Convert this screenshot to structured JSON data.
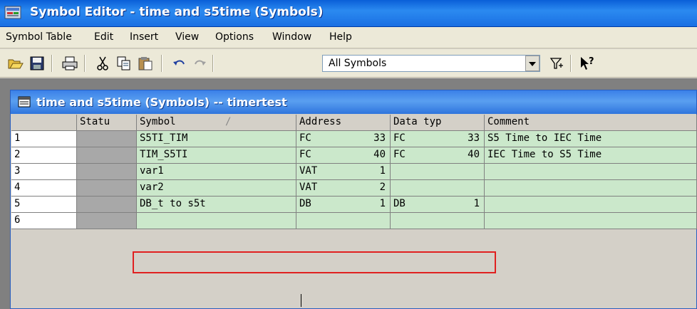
{
  "window": {
    "title": "Symbol Editor - time and s5time (Symbols)",
    "icon": "symbol-editor-icon"
  },
  "menu": {
    "items": [
      "Symbol Table",
      "Edit",
      "Insert",
      "View",
      "Options",
      "Window",
      "Help"
    ]
  },
  "toolbar": {
    "icons": [
      "open-folder-icon",
      "save-icon",
      "print-icon",
      "cut-icon",
      "copy-icon",
      "paste-icon",
      "undo-icon",
      "redo-icon",
      "filter-icon",
      "help-pointer-icon"
    ],
    "filter_value": "All Symbols"
  },
  "child_window": {
    "title": "time and s5time (Symbols) -- timertest"
  },
  "table": {
    "headers": {
      "rownum": "",
      "status": "Statu",
      "symbol": "Symbol",
      "sort_indicator": "/",
      "address": "Address",
      "datatype": "Data typ",
      "comment": "Comment"
    },
    "rows": [
      {
        "num": "1",
        "symbol": "S5TI_TIM",
        "addr_type": "FC",
        "addr_num": "33",
        "dt_type": "FC",
        "dt_num": "33",
        "comment": "S5 Time to IEC Time"
      },
      {
        "num": "2",
        "symbol": "TIM_S5TI",
        "addr_type": "FC",
        "addr_num": "40",
        "dt_type": "FC",
        "dt_num": "40",
        "comment": "IEC Time to S5 Time"
      },
      {
        "num": "3",
        "symbol": "var1",
        "addr_type": "VAT",
        "addr_num": "1",
        "dt_type": "",
        "dt_num": "",
        "comment": ""
      },
      {
        "num": "4",
        "symbol": "var2",
        "addr_type": "VAT",
        "addr_num": "2",
        "dt_type": "",
        "dt_num": "",
        "comment": ""
      },
      {
        "num": "5",
        "symbol": "DB_t to s5t",
        "addr_type": "DB",
        "addr_num": "1",
        "dt_type": "DB",
        "dt_num": "1",
        "comment": ""
      },
      {
        "num": "6",
        "symbol": "",
        "addr_type": "",
        "addr_num": "",
        "dt_type": "",
        "dt_num": "",
        "comment": ""
      }
    ]
  },
  "colors": {
    "cell_green": "#cbe8cb",
    "status_gray": "#a8a8a8",
    "highlight_red": "#e02020"
  }
}
